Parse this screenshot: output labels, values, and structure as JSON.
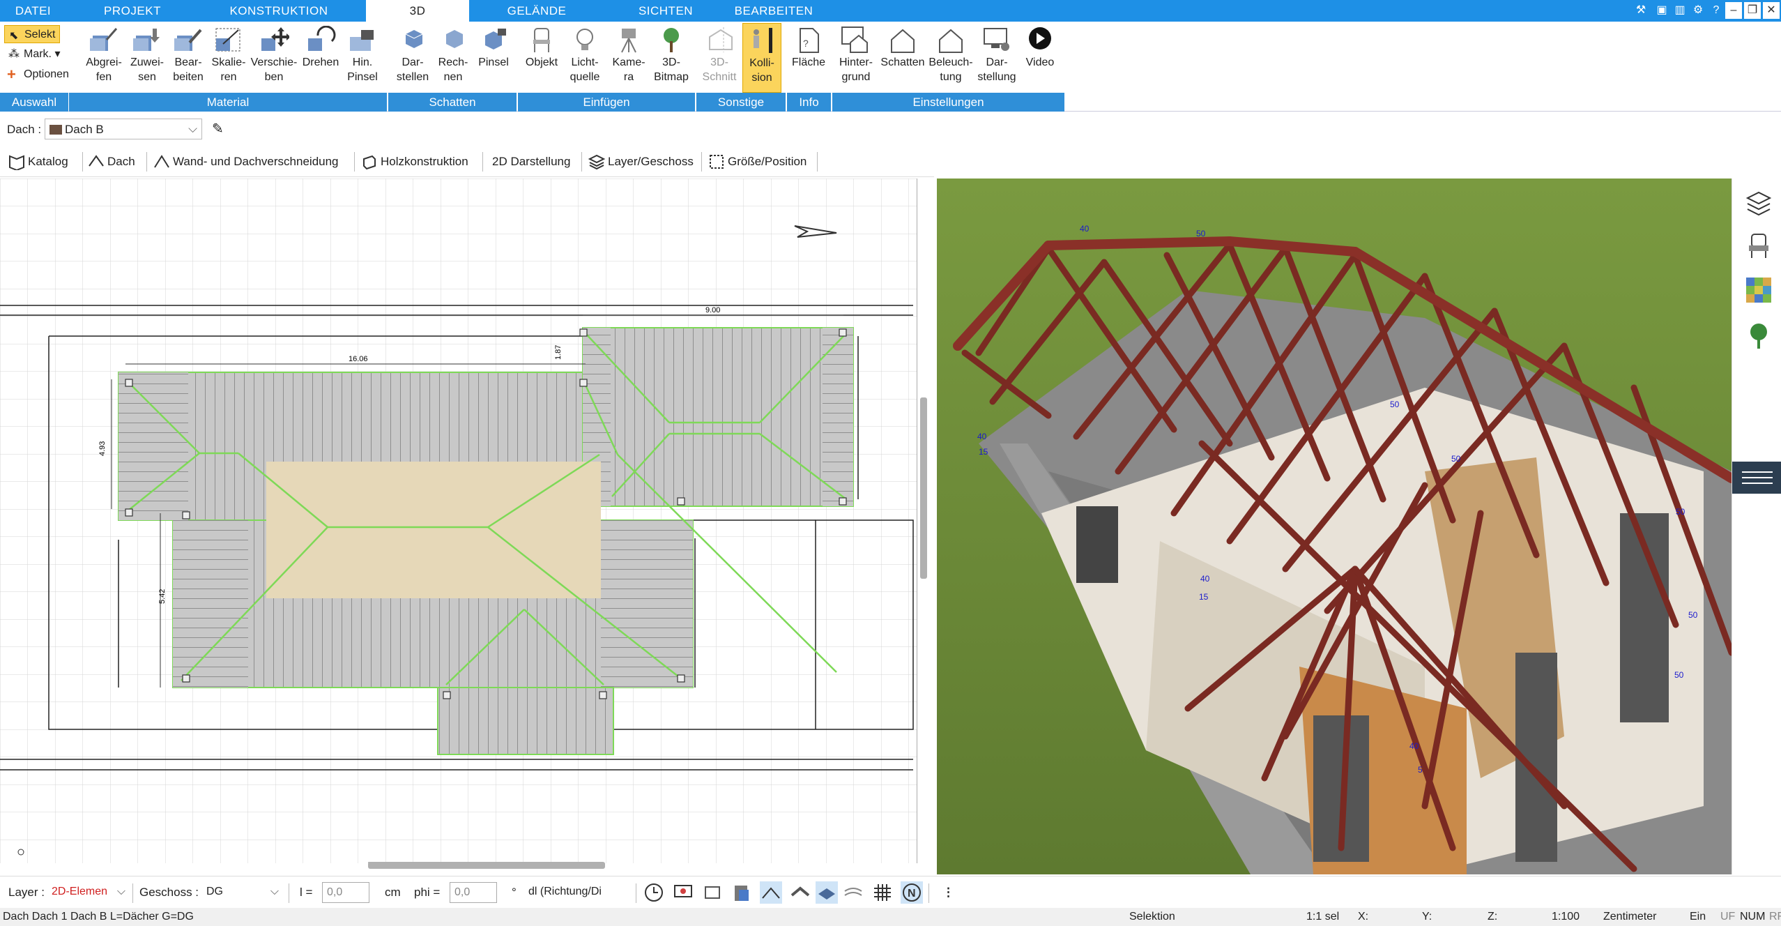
{
  "tabs": [
    "DATEI",
    "PROJEKT",
    "KONSTRUKTION",
    "3D",
    "GELÄNDE",
    "SICHTEN",
    "BEARBEITEN"
  ],
  "active_tab": "3D",
  "ribbon": {
    "auswahl": {
      "label": "Auswahl",
      "selekt": "Selekt",
      "mark": "Mark.",
      "optionen": "Optionen"
    },
    "material": {
      "label": "Material",
      "buttons": [
        "Abgrei-\nfen",
        "Zuwei-\nsen",
        "Bear-\nbeiten",
        "Skalie-\nren",
        "Verschie-\nben",
        "Drehen",
        "Hin.\nPinsel"
      ]
    },
    "schatten": {
      "label": "Schatten",
      "buttons": [
        "Dar-\nstellen",
        "Rech-\nnen",
        "Pinsel"
      ]
    },
    "einfuegen": {
      "label": "Einfügen",
      "buttons": [
        "Objekt",
        "Licht-\nquelle",
        "Kame-\nra",
        "3D-\nBitmap"
      ]
    },
    "sonstige": {
      "label": "Sonstige",
      "buttons": [
        "3D-\nSchnitt",
        "Kolli-\nsion"
      ]
    },
    "info": {
      "label": "Info",
      "buttons": [
        "Fläche"
      ]
    },
    "einstellungen": {
      "label": "Einstellungen",
      "buttons": [
        "Hinter-\ngrund",
        "Schatten",
        "Beleuch-\ntung",
        "Dar-\nstellung",
        "Video"
      ]
    }
  },
  "object_bar": {
    "label": "Dach :",
    "value": "Dach B"
  },
  "toolbar3": [
    "Katalog",
    "Dach",
    "Wand- und Dachverschneidung",
    "Holzkonstruktion",
    "2D Darstellung",
    "Layer/Geschoss",
    "Größe/Position"
  ],
  "dimensions": {
    "top": "9.00",
    "width": "16.06",
    "left": "4.93",
    "left2": "5.42",
    "small1": "1.87"
  },
  "labels_3d": [
    "40",
    "50",
    "15",
    "5"
  ],
  "bottom": {
    "layer_label": "Layer :",
    "layer_value": "2D-Elemen",
    "geschoss_label": "Geschoss :",
    "geschoss_value": "DG",
    "l_label": "l =",
    "l_value": "0,0",
    "l_unit": "cm",
    "phi_label": "phi =",
    "phi_value": "0,0",
    "phi_unit": "°",
    "dl_value": "dl (Richtung/Di"
  },
  "status": {
    "left": "Dach Dach 1 Dach B L=Dächer G=DG",
    "mode": "Selektion",
    "sel": "1:1 sel",
    "x": "X:",
    "y": "Y:",
    "z": "Z:",
    "scale": "1:100",
    "unit": "Zentimeter",
    "ein": "Ein",
    "uf": "UF",
    "num": "NUM",
    "rf": "RF"
  },
  "colors": {
    "tabbar": "#1e90e6",
    "group_label": "#2f8fd8",
    "highlight": "#fbd45c",
    "roof_green": "#7ed957",
    "rafters": "#7a2a22",
    "grass": "#6d8a3a"
  }
}
